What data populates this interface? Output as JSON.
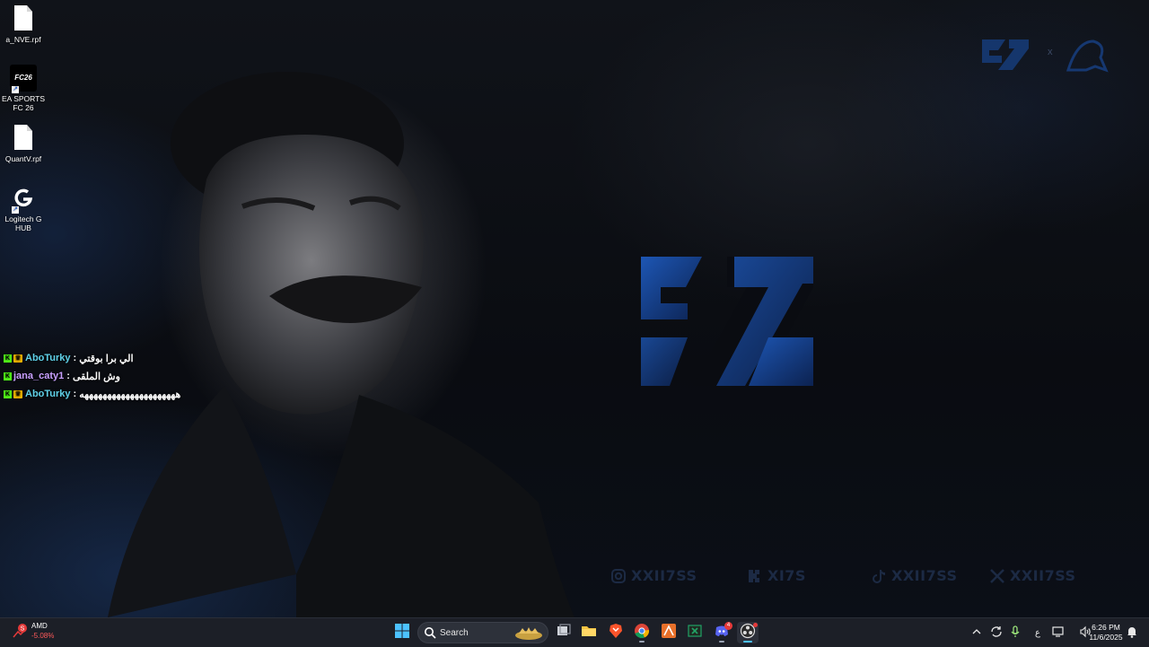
{
  "desktop": {
    "icons": [
      {
        "label": "a_NVE.rpf",
        "icon": "file-icon"
      },
      {
        "label": "EA SPORTS FC 26",
        "icon": "ea-sports-fc-icon",
        "badge": "FC26"
      },
      {
        "label": "QuantV.rpf",
        "icon": "file-icon"
      },
      {
        "label": "Logitech G HUB",
        "icon": "logitech-g-icon"
      }
    ]
  },
  "chat": {
    "messages": [
      {
        "user": "AboTurky",
        "user_color": "#5fd1e8",
        "separator": ":",
        "text": "الي برا بوقتي",
        "badges": [
          "kick-badge",
          "crown-badge"
        ]
      },
      {
        "user": "jana_caty1",
        "user_color": "#c9a0ff",
        "separator": ":",
        "text": "وش الملقى",
        "badges": [
          "kick-badge"
        ]
      },
      {
        "user": "AboTurky",
        "user_color": "#5fd1e8",
        "separator": ":",
        "text": "هههههههههههههههههههههه",
        "badges": [
          "kick-badge",
          "crown-badge"
        ]
      }
    ]
  },
  "wallpaper": {
    "top_logo_separator": "x",
    "socials": [
      {
        "icon": "instagram-icon",
        "handle": "XXII7SS"
      },
      {
        "icon": "kick-icon",
        "handle": "XI7S"
      },
      {
        "icon": "tiktok-icon",
        "handle": "XXII7SS"
      },
      {
        "icon": "x-icon",
        "handle": "XXII7SS"
      }
    ],
    "accent": "#1a4a9c"
  },
  "taskbar": {
    "widget": {
      "name": "AMD",
      "change": "-5.08%"
    },
    "search": {
      "placeholder": "Search"
    },
    "pinned": [
      "windows-start-icon",
      "task-view-icon",
      "file-explorer-icon",
      "brave-icon",
      "chrome-icon",
      "arch-app-icon",
      "excel-icon",
      "discord-icon",
      "obs-icon"
    ],
    "discord_badge": "4",
    "tray": {
      "language": "ع"
    },
    "clock": {
      "time": "6:26 PM",
      "date": "11/6/2025"
    }
  }
}
